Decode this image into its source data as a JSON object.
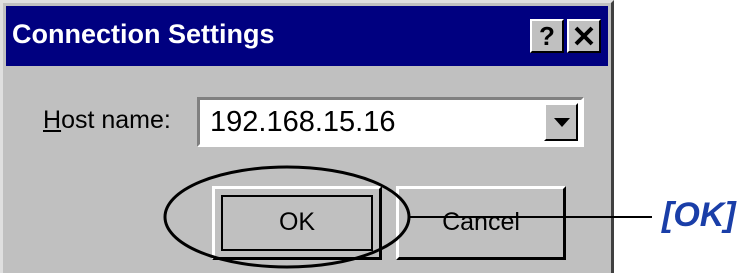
{
  "dialog": {
    "title": "Connection Settings",
    "help_button": "?",
    "close_button": "✕"
  },
  "host": {
    "label_mnemonic": "H",
    "label_rest": "ost name:",
    "value": "192.168.15.16"
  },
  "buttons": {
    "ok": "OK",
    "cancel": "Cancel"
  },
  "annotation": {
    "callout": "[OK]"
  },
  "colors": {
    "title_bar": "#000080",
    "dialog_face": "#c0c0c0",
    "callout_text": "#1a3ea8"
  },
  "icons": {
    "dropdown": "chevron-down-icon"
  }
}
